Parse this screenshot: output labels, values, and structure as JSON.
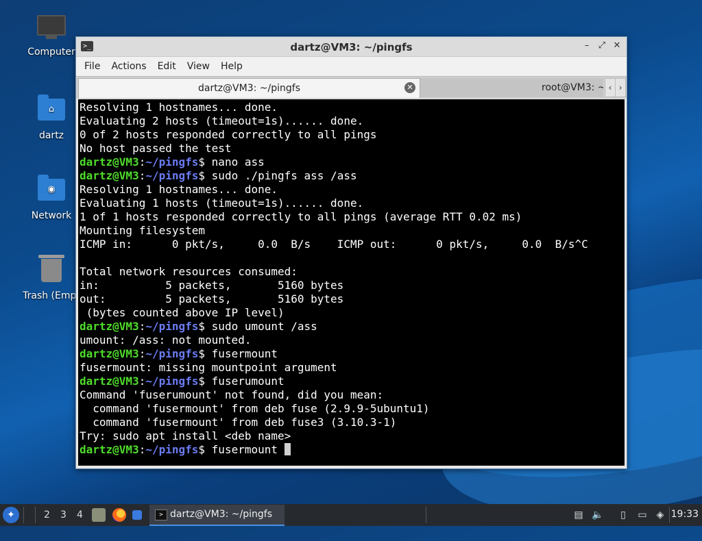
{
  "desktop": {
    "icons": [
      {
        "label": "Computer",
        "icon": "computer-icon"
      },
      {
        "label": "dartz",
        "icon": "home-folder-icon"
      },
      {
        "label": "Network",
        "icon": "network-folder-icon"
      },
      {
        "label": "Trash (Empt",
        "icon": "trash-icon"
      }
    ]
  },
  "window": {
    "title": "dartz@VM3: ~/pingfs",
    "menu": [
      "File",
      "Actions",
      "Edit",
      "View",
      "Help"
    ],
    "tabs": [
      {
        "label": "dartz@VM3: ~/pingfs",
        "active": true
      },
      {
        "label": "root@VM3: ~",
        "active": false
      }
    ]
  },
  "terminal": {
    "prompt": {
      "user": "dartz@VM3",
      "colon": ":",
      "path": "~/pingfs",
      "symbol": "$ "
    },
    "lines": [
      {
        "type": "out",
        "text": "Resolving 1 hostnames... done."
      },
      {
        "type": "out",
        "text": "Evaluating 2 hosts (timeout=1s)...... done."
      },
      {
        "type": "out",
        "text": "0 of 2 hosts responded correctly to all pings"
      },
      {
        "type": "out",
        "text": "No host passed the test"
      },
      {
        "type": "cmd",
        "text": "nano ass"
      },
      {
        "type": "cmd",
        "text": "sudo ./pingfs ass /ass"
      },
      {
        "type": "out",
        "text": "Resolving 1 hostnames... done."
      },
      {
        "type": "out",
        "text": "Evaluating 1 hosts (timeout=1s)...... done."
      },
      {
        "type": "out",
        "text": "1 of 1 hosts responded correctly to all pings (average RTT 0.02 ms)"
      },
      {
        "type": "out",
        "text": "Mounting filesystem"
      },
      {
        "type": "out",
        "text": "ICMP in:      0 pkt/s,     0.0  B/s    ICMP out:      0 pkt/s,     0.0  B/s^C"
      },
      {
        "type": "out",
        "text": ""
      },
      {
        "type": "out",
        "text": "Total network resources consumed:"
      },
      {
        "type": "out",
        "text": "in:          5 packets,       5160 bytes"
      },
      {
        "type": "out",
        "text": "out:         5 packets,       5160 bytes"
      },
      {
        "type": "out",
        "text": " (bytes counted above IP level)"
      },
      {
        "type": "cmd",
        "text": "sudo umount /ass"
      },
      {
        "type": "out",
        "text": "umount: /ass: not mounted."
      },
      {
        "type": "cmd",
        "text": "fusermount"
      },
      {
        "type": "out",
        "text": "fusermount: missing mountpoint argument"
      },
      {
        "type": "cmd",
        "text": "fuserumount"
      },
      {
        "type": "out",
        "text": "Command 'fuserumount' not found, did you mean:"
      },
      {
        "type": "out",
        "text": "  command 'fusermount' from deb fuse (2.9.9-5ubuntu1)"
      },
      {
        "type": "out",
        "text": "  command 'fusermount' from deb fuse3 (3.10.3-1)"
      },
      {
        "type": "out",
        "text": "Try: sudo apt install <deb name>"
      },
      {
        "type": "cmd",
        "text": "fusermount ",
        "cursor": true
      }
    ]
  },
  "taskbar": {
    "workspaces": [
      "2",
      "3",
      "4"
    ],
    "task_label": "dartz@VM3: ~/pingfs",
    "clock": "19:33"
  }
}
